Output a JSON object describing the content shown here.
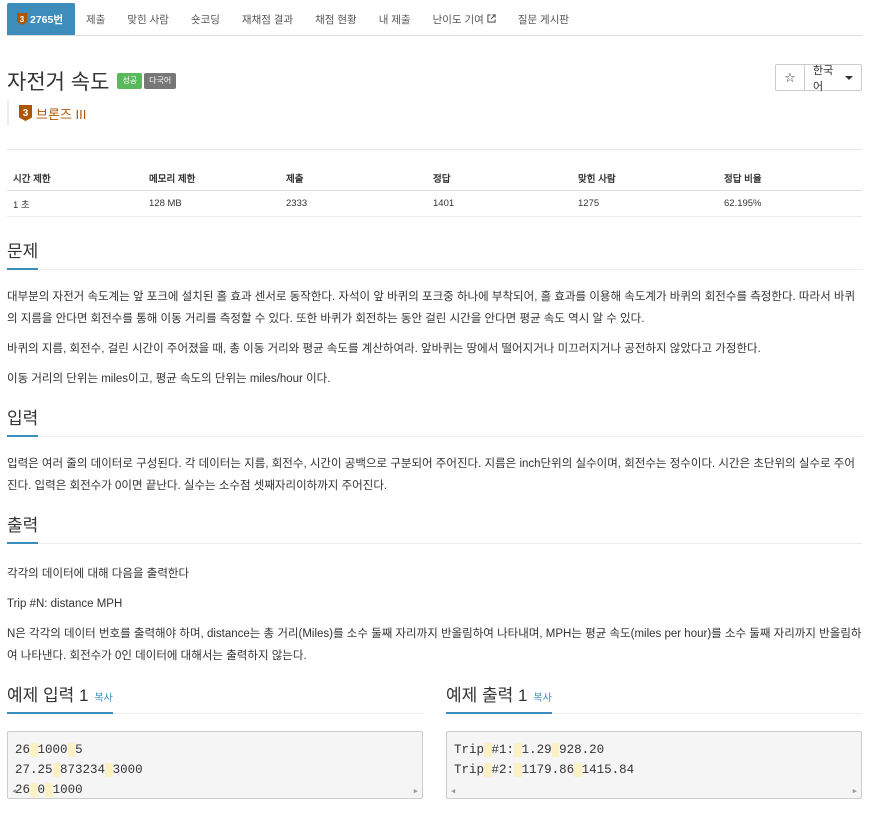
{
  "nav": {
    "items": [
      {
        "label": "2765번",
        "tier": "3",
        "active": true
      },
      {
        "label": "제출"
      },
      {
        "label": "맞힌 사람"
      },
      {
        "label": "숏코딩"
      },
      {
        "label": "재채점 결과"
      },
      {
        "label": "채점 현황"
      },
      {
        "label": "내 제출"
      },
      {
        "label": "난이도 기여",
        "external": true
      },
      {
        "label": "질문 게시판"
      }
    ]
  },
  "problem": {
    "title": "자전거 속도",
    "labels": {
      "success": "성공",
      "multilang": "다국어"
    },
    "tier_number": "3",
    "tier_text": "브론즈 III"
  },
  "tools": {
    "star_icon": "☆",
    "language": "한국어"
  },
  "stats": {
    "headers": [
      "시간 제한",
      "메모리 제한",
      "제출",
      "정답",
      "맞힌 사람",
      "정답 비율"
    ],
    "values": [
      "1 초",
      "128 MB",
      "2333",
      "1401",
      "1275",
      "62.195%"
    ]
  },
  "sections": {
    "description": {
      "title": "문제",
      "paragraphs": [
        "대부분의 자전거 속도계는 앞 포크에 설치된 홀 효과 센서로 동작한다. 자석이 앞 바퀴의 포크중 하나에 부착되어, 홀 효과를 이용해 속도계가 바퀴의 회전수를 측정한다. 따라서 바퀴의 지름을 안다면 회전수를 통해 이동 거리를 측정할 수 있다. 또한 바퀴가 회전하는 동안 걸린 시간을 안다면 평균 속도 역시 알 수 있다.",
        "바퀴의 지름, 회전수, 걸린 시간이 주어졌을 때, 총 이동 거리와 평균 속도를 계산하여라. 앞바퀴는 땅에서 떨어지거나 미끄러지거나 공전하지 않았다고 가정한다.",
        "이동 거리의 단위는 miles이고, 평균 속도의 단위는 miles/hour 이다."
      ]
    },
    "input": {
      "title": "입력",
      "paragraphs": [
        "입력은 여러 줄의 데이터로 구성된다. 각 데이터는 지름, 회전수, 시간이 공백으로 구분되어 주어진다. 지름은 inch단위의 실수이며, 회전수는 정수이다. 시간은 초단위의 실수로 주어진다. 입력은 회전수가 0이면 끝난다. 실수는 소수점 셋째자리이하까지 주어진다."
      ]
    },
    "output": {
      "title": "출력",
      "paragraphs": [
        "각각의 데이터에 대해 다음을 출력한다",
        "Trip #N: distance MPH",
        "N은 각각의 데이터 번호를 출력해야 하며, distance는 총 거리(Miles)를 소수 둘째 자리까지 반올림하여 나타내며, MPH는 평균 속도(miles per hour)를 소수 둘째 자리까지 반올림하여 나타낸다. 회전수가 0인 데이터에 대해서는 출력하지 않는다."
      ]
    }
  },
  "samples": {
    "input": {
      "title": "예제 입력 1",
      "copy": "복사",
      "lines": [
        [
          "26",
          "1000",
          "5"
        ],
        [
          "27.25",
          "873234",
          "3000"
        ],
        [
          "26",
          "0",
          "1000"
        ]
      ]
    },
    "output": {
      "title": "예제 출력 1",
      "copy": "복사",
      "lines": [
        [
          "Trip",
          "#1:",
          "1.29",
          "928.20"
        ],
        [
          "Trip",
          "#2:",
          "1179.86",
          "1415.84"
        ]
      ]
    }
  }
}
